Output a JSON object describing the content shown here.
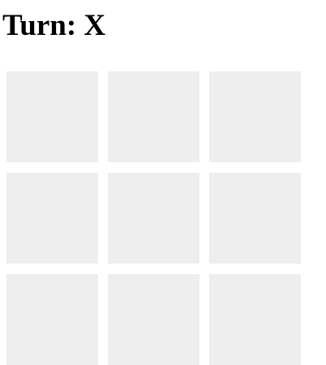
{
  "header": {
    "turn_label": "Turn: X",
    "current_player": "X"
  },
  "board": {
    "rows": 3,
    "cols": 3,
    "cells": [
      "",
      "",
      "",
      "",
      "",
      "",
      "",
      "",
      ""
    ],
    "cell_color": "#eeeeee"
  }
}
